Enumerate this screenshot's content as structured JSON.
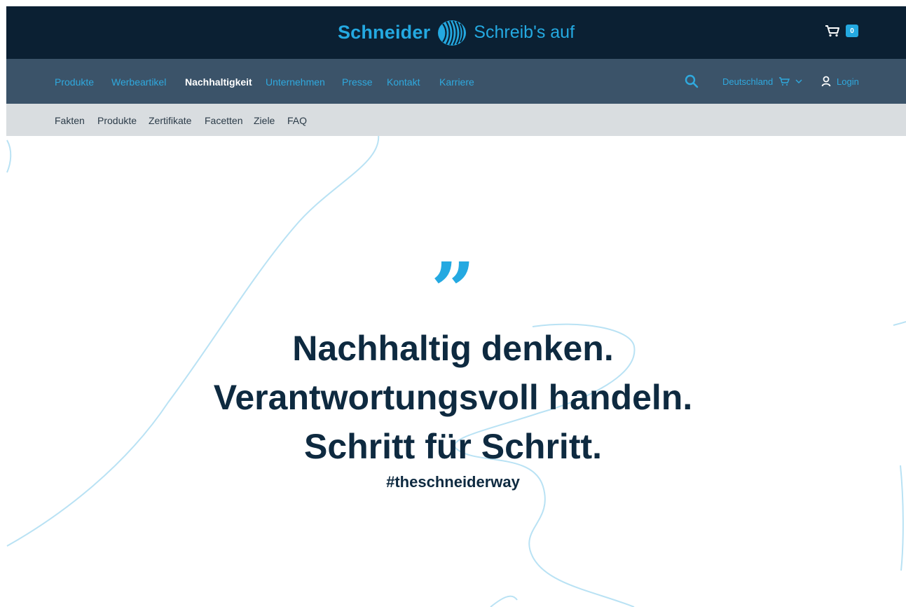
{
  "header": {
    "brand": "Schneider",
    "tagline": "Schreib's auf",
    "cart_count": "0",
    "logo_icon": "schneider-wave-logo",
    "cart_icon": "shopping-cart-icon"
  },
  "main_nav": {
    "items": [
      {
        "label": "Produkte",
        "active": false
      },
      {
        "label": "Werbeartikel",
        "active": false
      },
      {
        "label": "Nachhaltigkeit",
        "active": true
      },
      {
        "label": "Unternehmen",
        "active": false
      },
      {
        "label": "Presse",
        "active": false
      },
      {
        "label": "Kontakt",
        "active": false
      },
      {
        "label": "Karriere",
        "active": false
      }
    ],
    "country": "Deutschland",
    "login": "Login"
  },
  "sub_nav": {
    "items": [
      "Fakten",
      "Produkte",
      "Zertifikate",
      "Facetten",
      "Ziele",
      "FAQ"
    ]
  },
  "hero": {
    "quote_mark": "”",
    "lines": [
      "Nachhaltig denken.",
      "Verantwortungsvoll handeln.",
      "Schritt für Schritt."
    ],
    "hashtag": "#theschneiderway"
  },
  "colors": {
    "dark_navy": "#0b2033",
    "nav_slate": "#3b5369",
    "accent_blue": "#24a9e1",
    "subnav_gray": "#d9dde0",
    "headline": "#0e2a40"
  }
}
